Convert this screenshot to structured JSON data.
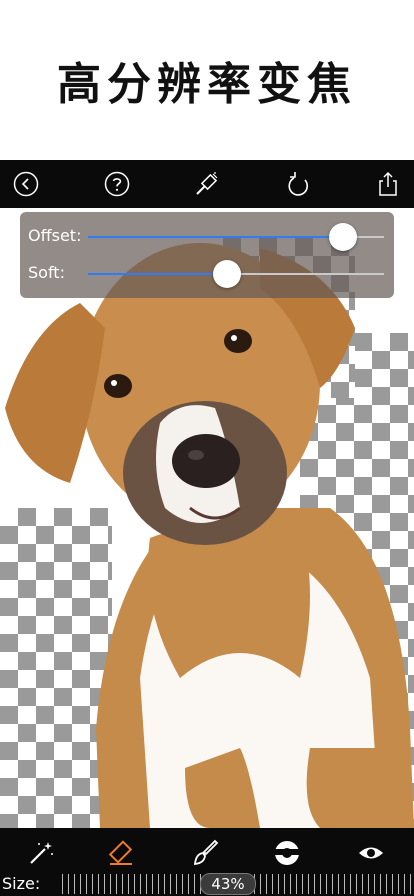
{
  "headline": "高分辨率变焦",
  "toolbar": {
    "back_icon": "chevron-left-circle-icon",
    "help_icon": "question-circle-icon",
    "brush_icon": "magic-brush-icon",
    "undo_icon": "undo-icon",
    "share_icon": "share-icon"
  },
  "panel": {
    "offset_label": "Offset:",
    "offset_value": 0.86,
    "soft_label": "Soft:",
    "soft_value": 0.47
  },
  "bottom_tools": [
    {
      "name": "magic-wand-icon",
      "active": false
    },
    {
      "name": "eraser-icon",
      "active": true
    },
    {
      "name": "brush-icon",
      "active": false
    },
    {
      "name": "circle-mask-icon",
      "active": false
    },
    {
      "name": "eye-icon",
      "active": false
    }
  ],
  "size": {
    "label": "Size:",
    "value": "43%"
  },
  "colors": {
    "accent": "#f07a2a",
    "slider_fill": "#2f7cf6",
    "bar_bg": "#0a0a0a"
  }
}
